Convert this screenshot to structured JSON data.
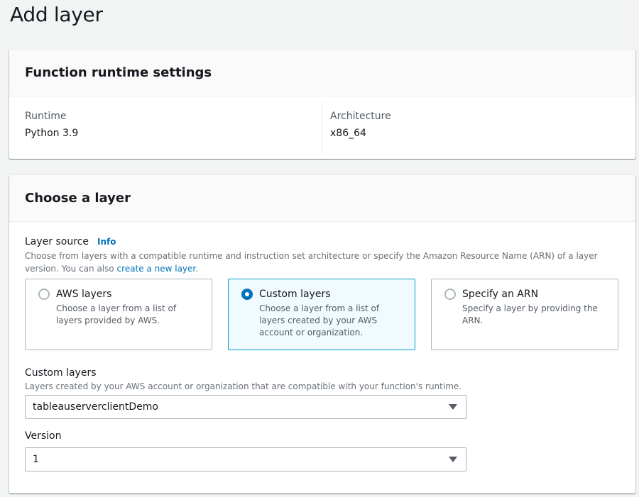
{
  "page": {
    "title": "Add layer"
  },
  "runtime_panel": {
    "title": "Function runtime settings",
    "runtime_label": "Runtime",
    "runtime_value": "Python 3.9",
    "architecture_label": "Architecture",
    "architecture_value": "x86_64"
  },
  "layer_panel": {
    "title": "Choose a layer",
    "source_label": "Layer source",
    "info_link": "Info",
    "source_desc_prefix": "Choose from layers with a compatible runtime and instruction set architecture or specify the Amazon Resource Name (ARN) of a layer version. You can also ",
    "source_desc_link": "create a new layer",
    "source_desc_suffix": ".",
    "options": [
      {
        "title": "AWS layers",
        "desc": "Choose a layer from a list of layers provided by AWS.",
        "selected": false
      },
      {
        "title": "Custom layers",
        "desc": "Choose a layer from a list of layers created by your AWS account or organization.",
        "selected": true
      },
      {
        "title": "Specify an ARN",
        "desc": "Specify a layer by providing the ARN.",
        "selected": false
      }
    ],
    "custom_layers_label": "Custom layers",
    "custom_layers_desc": "Layers created by your AWS account or organization that are compatible with your function's runtime.",
    "custom_layers_value": "tableauserverclientDemo",
    "version_label": "Version",
    "version_value": "1"
  },
  "colors": {
    "accent": "#0073bb",
    "selected_border": "#00a1c9",
    "selected_bg": "#f1faff"
  }
}
